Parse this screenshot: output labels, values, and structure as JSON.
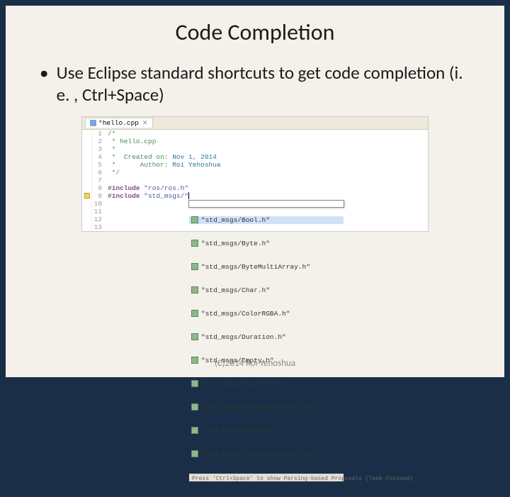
{
  "title": "Code Completion",
  "bullet": "Use Eclipse standard shortcuts to get code completion (i. e. , Ctrl+Space)",
  "tab": {
    "label": "*hello.cpp"
  },
  "line_numbers": [
    "1",
    "2",
    "3",
    "4",
    "5",
    "6",
    "7",
    "8",
    "9",
    "10",
    "11",
    "12",
    "13"
  ],
  "code": {
    "l1": "/*",
    "l2": " * hello.cpp",
    "l3": " *",
    "l4_a": " *  Created on: ",
    "l4_b": "Nov 1, 2014",
    "l5_a": " *      Author: ",
    "l5_b": "Roi Yehoshua",
    "l6": " */",
    "l7": "",
    "l8_a": "#include",
    "l8_b": " \"ros/ros.h\"",
    "l9_a": "#include",
    "l9_b": " \"std_msgs/\""
  },
  "completion": {
    "items": [
      "\"std_msgs/Bool.h\"",
      "\"std_msgs/Byte.h\"",
      "\"std_msgs/ByteMultiArray.h\"",
      "\"std_msgs/Char.h\"",
      "\"std_msgs/ColorRGBA.h\"",
      "\"std_msgs/Duration.h\"",
      "\"std_msgs/Empty.h\"",
      "\"std_msgs/Float32.h\"",
      "\"std_msgs/Float32MultiArray.h\"",
      "\"std_msgs/Float64.h\"",
      "\"std_msgs/Float64MultiArray.h\""
    ],
    "footer": "Press 'Ctrl+Space' to show Parsing-based Proposals (Task-Focused)"
  },
  "copyright": "(C)2014 Roi Yehoshua"
}
